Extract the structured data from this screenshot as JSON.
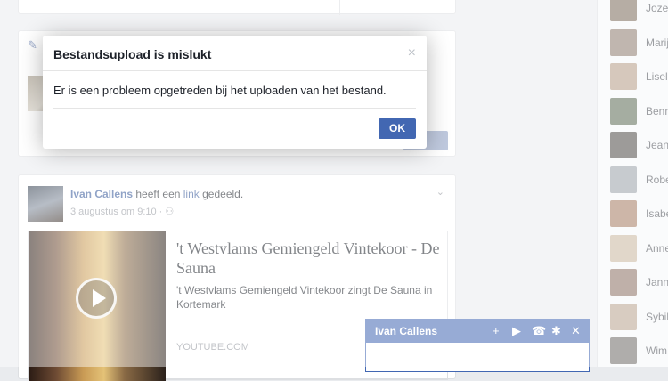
{
  "dialog": {
    "title": "Bestandsupload is mislukt",
    "message": "Er is een probleem opgetreden bij het uploaden van het bestand.",
    "ok_label": "OK",
    "close_glyph": "×"
  },
  "post": {
    "author": "Ivan Callens",
    "verb": "heeft een",
    "link_word": "link",
    "suffix": "gedeeld.",
    "timestamp": "3 augustus om 9:10 ·",
    "share": {
      "title": "'t Westvlams Gemiengeld Vintekoor - De Sauna",
      "description": "'t Westvlams Gemiengeld Vintekoor zingt De Sauna in Kortemark",
      "source": "YOUTUBE.COM"
    }
  },
  "chat": {
    "name": "Ivan Callens",
    "icons": {
      "add": "+",
      "video": "▶",
      "call": "☎",
      "settings": "✱",
      "close": "✕"
    }
  },
  "contacts": [
    {
      "name": "Joze",
      "color": "#7b6a5a"
    },
    {
      "name": "Marij",
      "color": "#8c7b6e"
    },
    {
      "name": "Lisel",
      "color": "#b49b86"
    },
    {
      "name": "Benn",
      "color": "#5c6b55"
    },
    {
      "name": "Jean-",
      "color": "#4e4a46"
    },
    {
      "name": "Robe",
      "color": "#9aa0a8"
    },
    {
      "name": "Isabe",
      "color": "#a47a61"
    },
    {
      "name": "Anne",
      "color": "#c9b79f"
    },
    {
      "name": "Janni",
      "color": "#8a6f63"
    },
    {
      "name": "Sybil",
      "color": "#b8a28f"
    },
    {
      "name": "Wim",
      "color": "#6e6a66"
    }
  ]
}
